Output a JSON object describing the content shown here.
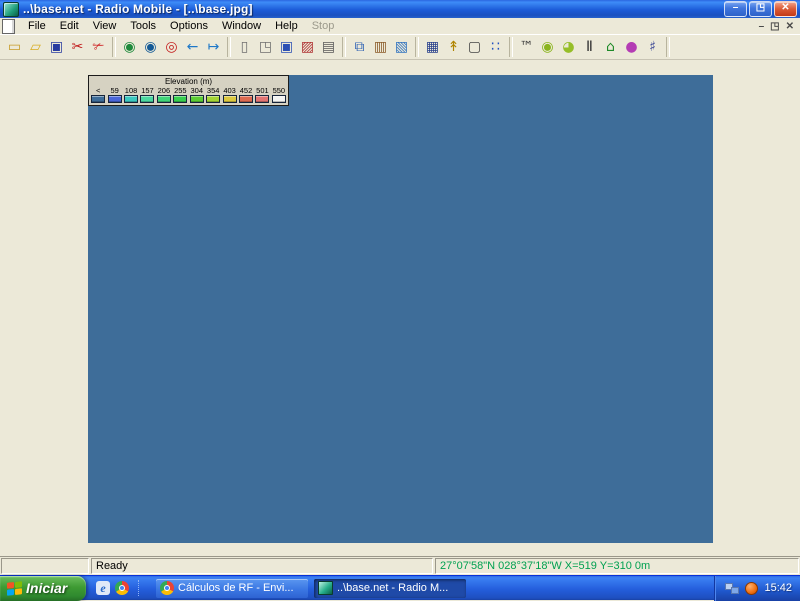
{
  "window": {
    "title": "..\\base.net - Radio Mobile - [..\\base.jpg]",
    "controls": {
      "minimize": "–",
      "restore": "◳",
      "close": "✕"
    }
  },
  "menu": {
    "items": [
      "File",
      "Edit",
      "View",
      "Tools",
      "Options",
      "Window",
      "Help",
      "Stop"
    ],
    "disabled_item": "Stop",
    "child_controls": {
      "minimize": "–",
      "restore": "◳",
      "close": "✕"
    }
  },
  "toolbar": {
    "icons": [
      {
        "name": "new-networks-file-icon",
        "glyph": "▭",
        "color": "#c89c28"
      },
      {
        "name": "open-networks-file-icon",
        "glyph": "▱",
        "color": "#d8ac20"
      },
      {
        "name": "save-networks-file-icon",
        "glyph": "▣",
        "color": "#283ca0"
      },
      {
        "name": "network-scissors-icon",
        "glyph": "✂",
        "color": "#c01818"
      },
      {
        "name": "unit-scissors-icon",
        "glyph": "✃",
        "color": "#d03030"
      },
      {
        "name": "map-properties-globe-icon",
        "glyph": "◉",
        "color": "#1e8a3c"
      },
      {
        "name": "save-map-globe-icon",
        "glyph": "◉",
        "color": "#145a96"
      },
      {
        "name": "map-quality-globe-icon",
        "glyph": "◎",
        "color": "#c42020"
      },
      {
        "name": "previous-map-arrow-icon",
        "glyph": "←",
        "color": "#1e78c8"
      },
      {
        "name": "next-map-arrow-icon",
        "glyph": "↦",
        "color": "#1e78c8"
      },
      {
        "name": "new-picture-icon",
        "glyph": "▯",
        "color": "#707070"
      },
      {
        "name": "clone-picture-icon",
        "glyph": "◳",
        "color": "#707070"
      },
      {
        "name": "save-picture-icon",
        "glyph": "▣",
        "color": "#2c50b4"
      },
      {
        "name": "delete-picture-icon",
        "glyph": "▨",
        "color": "#b03434"
      },
      {
        "name": "print-picture-icon",
        "glyph": "▤",
        "color": "#5a5a5a"
      },
      {
        "name": "copy-icon",
        "glyph": "⧉",
        "color": "#3264b4"
      },
      {
        "name": "paste-icon",
        "glyph": "▥",
        "color": "#8a5a28"
      },
      {
        "name": "export-picture-icon",
        "glyph": "▧",
        "color": "#3274c0"
      },
      {
        "name": "merge-pictures-icon",
        "glyph": "▦",
        "color": "#28408c"
      },
      {
        "name": "unit-properties-icon",
        "glyph": "↟",
        "color": "#b08400"
      },
      {
        "name": "select-rectangle-icon",
        "glyph": "▢",
        "color": "#464646"
      },
      {
        "name": "align-units-icon",
        "glyph": "∷",
        "color": "#2050c0"
      },
      {
        "name": "link-endpoints-icon",
        "glyph": "™",
        "color": "#3a3a3a"
      },
      {
        "name": "single-coverage-icon",
        "glyph": "◉",
        "color": "#8ab41e"
      },
      {
        "name": "combined-coverage-icon",
        "glyph": "◕",
        "color": "#96be28"
      },
      {
        "name": "interference-icon",
        "glyph": "Ⅱ",
        "color": "#323232"
      },
      {
        "name": "route-coverage-icon",
        "glyph": "⌂",
        "color": "#1e8a28"
      },
      {
        "name": "visual-coverage-icon",
        "glyph": "●",
        "color": "#b43cb4"
      },
      {
        "name": "antenna-pattern-icon",
        "glyph": "♯",
        "color": "#3c4896"
      }
    ]
  },
  "legend": {
    "title": "Elevation (m)",
    "entries": [
      {
        "label": "<",
        "color": "#3e6d99"
      },
      {
        "label": "59",
        "color": "#4a66d8"
      },
      {
        "label": "108",
        "color": "#3cc8c0"
      },
      {
        "label": "157",
        "color": "#4cd8a0"
      },
      {
        "label": "206",
        "color": "#40d478"
      },
      {
        "label": "255",
        "color": "#38ce4e"
      },
      {
        "label": "304",
        "color": "#5ccc34"
      },
      {
        "label": "354",
        "color": "#a4d434"
      },
      {
        "label": "403",
        "color": "#dcc83e"
      },
      {
        "label": "452",
        "color": "#dc6a50"
      },
      {
        "label": "501",
        "color": "#e27472"
      },
      {
        "label": "550",
        "color": "#f4f4f2"
      }
    ]
  },
  "statusbar": {
    "message": "Ready",
    "coordinates": "27°07'58\"N 028°37'18\"W  X=519 Y=310 0m"
  },
  "taskbar": {
    "start_label": "Iniciar",
    "tasks": [
      {
        "label": "Cálculos de RF - Envi..."
      },
      {
        "label": "..\\base.net - Radio M..."
      }
    ],
    "clock": "15:42"
  },
  "colors": {
    "map_background": "#3e6d99",
    "status_coordinates_text": "#00a050",
    "xp_taskbar_blue": "#245edc",
    "start_button_green": "#2f8a2f"
  }
}
